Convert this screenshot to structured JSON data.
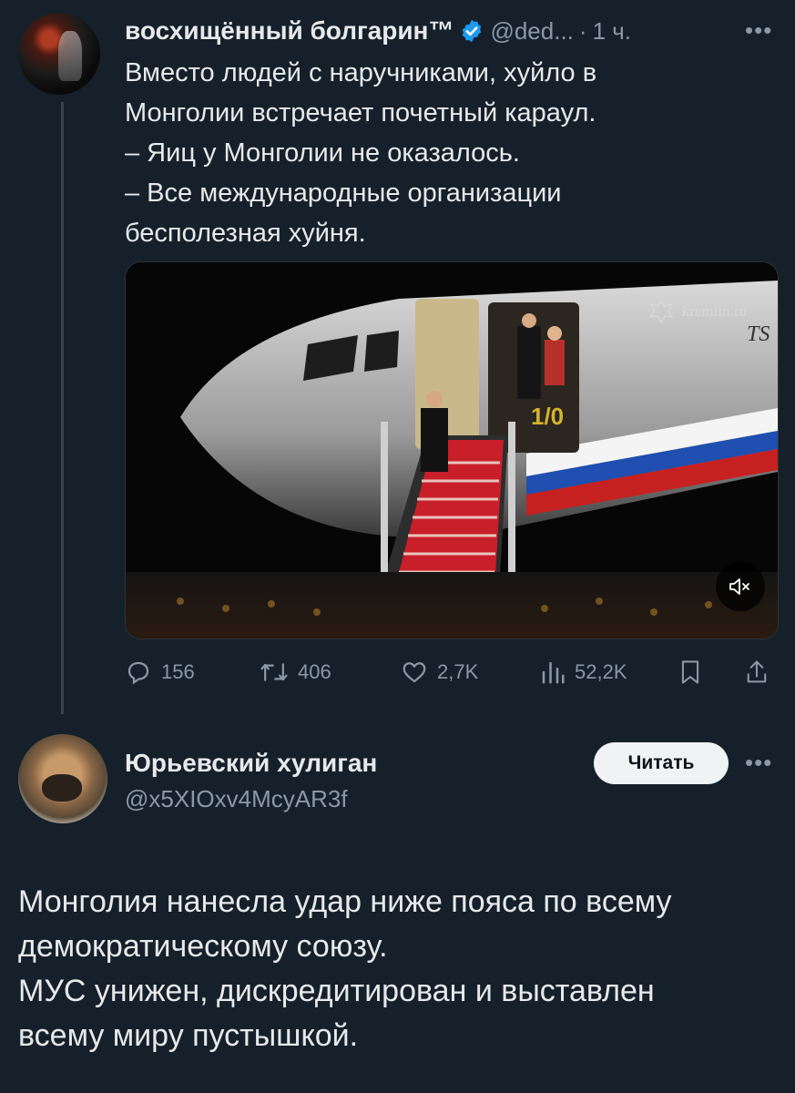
{
  "tweet1": {
    "author_name": "восхищённый болгарин™",
    "handle": "@ded...",
    "separator": "·",
    "time": "1 ч.",
    "text_lines": [
      "Вместо людей с наручниками, хуйло в",
      "Монголии встречает почетный караул.",
      "– Яиц у Монголии не оказалось.",
      "– Все международные организации",
      "бесполезная хуйня."
    ],
    "media": {
      "watermark": "kremlin.ru",
      "plane_mark": "TS",
      "door_mark": "1/0",
      "mute_icon": "speaker-muted-icon"
    },
    "actions": {
      "replies": "156",
      "retweets": "406",
      "likes": "2,7K",
      "views": "52,2K"
    },
    "icons": [
      "verified-badge-icon",
      "more-icon",
      "reply-icon",
      "retweet-icon",
      "like-icon",
      "views-icon",
      "bookmark-icon",
      "share-icon"
    ]
  },
  "tweet2": {
    "author_name": "Юрьевский хулиган",
    "handle": "@x5XIOxv4McyAR3f",
    "follow_label": "Читать",
    "text_lines": [
      "Монголия нанесла удар ниже пояса по всему",
      "демократическому союзу.",
      "МУС унижен, дискредитирован и выставлен",
      "всему миру пустышкой."
    ]
  },
  "colors": {
    "background": "#15202b",
    "text": "#e7e9ea",
    "secondary_text": "#8b98a5",
    "verified_blue": "#1d9bf0",
    "thread_line": "#38444d",
    "follow_button": "#eff3f4"
  }
}
